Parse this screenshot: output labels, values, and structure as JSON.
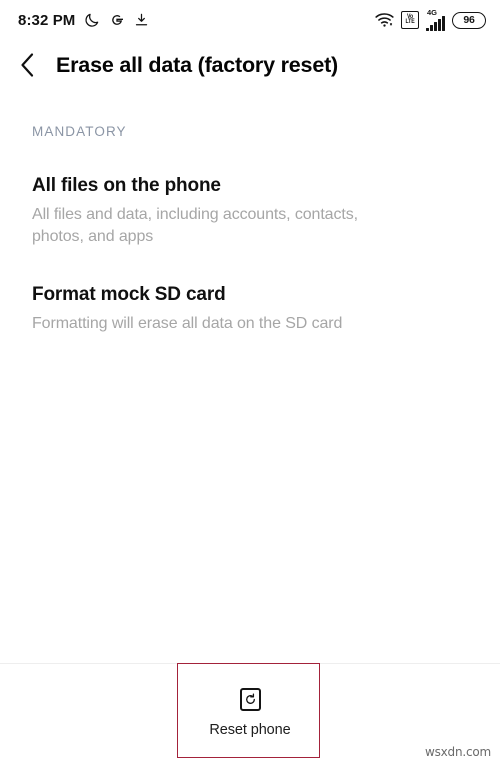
{
  "status_bar": {
    "time": "8:32 PM",
    "left_icons": [
      {
        "name": "do-not-disturb-moon-icon",
        "label": "Do not disturb"
      },
      {
        "name": "google-g-icon",
        "label": "Google"
      },
      {
        "name": "download-icon",
        "label": "Download"
      }
    ],
    "right_icons": [
      {
        "name": "wifi-icon",
        "label": "Wi-Fi"
      },
      {
        "name": "volte-icon",
        "label": "VoLTE",
        "text_top": "Vo",
        "text_bottom": "LTE"
      },
      {
        "name": "cellular-signal-icon",
        "label": "4G signal",
        "network": "4G"
      }
    ],
    "battery": {
      "level": "96",
      "name": "battery-icon"
    }
  },
  "header": {
    "back_label": "Back",
    "title": "Erase all data (factory reset)"
  },
  "content": {
    "section_header": "MANDATORY",
    "items": [
      {
        "title": "All files on the phone",
        "description": "All files and data, including accounts, contacts, photos, and apps"
      },
      {
        "title": "Format mock SD card",
        "description": "Formatting will erase all data on the SD card"
      }
    ]
  },
  "bottom_bar": {
    "reset_label": "Reset phone",
    "reset_icon": "reset-phone-icon"
  },
  "annotation": {
    "color": "#a3223a",
    "target": "reset-phone-button"
  },
  "watermark": {
    "text": "wsxdn.com"
  }
}
